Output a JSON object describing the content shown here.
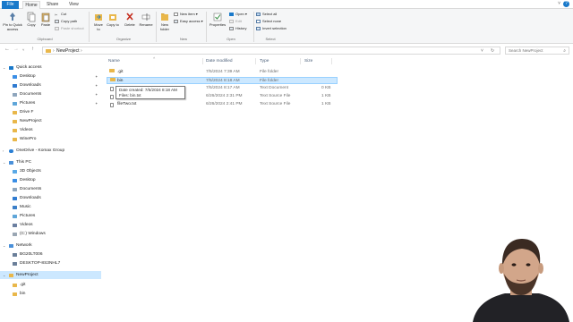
{
  "tabs": {
    "file": "File",
    "home": "Home",
    "share": "Share",
    "view": "View"
  },
  "ribbon": {
    "pin_quick_access": "Pin to Quick access",
    "copy": "Copy",
    "paste": "Paste",
    "cut": "Cut",
    "copy_path": "Copy path",
    "paste_shortcut": "Paste shortcut",
    "clipboard_group": "Clipboard",
    "move_to": "Move to",
    "copy_to": "Copy to",
    "delete": "Delete",
    "rename": "Rename",
    "organize_group": "Organize",
    "new_folder": "New folder",
    "new_item": "New item",
    "easy_access": "Easy access",
    "new_group": "New",
    "properties": "Properties",
    "open": "Open",
    "edit": "Edit",
    "history": "History",
    "open_group": "Open",
    "select_all": "Select all",
    "select_none": "Select none",
    "invert_selection": "Invert selection",
    "select_group": "Select"
  },
  "address": {
    "crumb": "NewProject",
    "search_placeholder": "Search NewProject"
  },
  "navpane": {
    "quick_access": "Quick access",
    "quick_items": [
      "Desktop",
      "Downloads",
      "Documents",
      "Pictures",
      "Drive F",
      "NewProject",
      "Videos",
      "WinePro"
    ],
    "onedrive": "OneDrive - Komax Group",
    "this_pc": "This PC",
    "pc_items": [
      "3D Objects",
      "Desktop",
      "Documents",
      "Downloads",
      "Music",
      "Pictures",
      "Videos",
      "(C:) Windows"
    ],
    "network": "Network",
    "network_items": [
      "BG20LT006",
      "DESKTOP-8S3NHL7"
    ],
    "current_folder": "NewProject",
    "sub_items": [
      ".git",
      "bin"
    ]
  },
  "columns": {
    "name": "Name",
    "date": "Date modified",
    "type": "Type",
    "size": "Size"
  },
  "files": [
    {
      "name": ".git",
      "date": "7/5/2024 7:39 AM",
      "type": "File folder",
      "size": ""
    },
    {
      "name": "bin",
      "date": "7/5/2024 8:18 AM",
      "type": "File folder",
      "size": ""
    },
    {
      "name": "",
      "date": "7/5/2024 8:17 AM",
      "type": "Text Document",
      "size": "0 KB"
    },
    {
      "name": "",
      "date": "6/26/2024 2:31 PM",
      "type": "Text Source File",
      "size": "1 KB"
    },
    {
      "name": "fileTwo.txt",
      "date": "6/26/2024 2:41 PM",
      "type": "Text Source File",
      "size": "1 KB"
    }
  ],
  "tooltip": {
    "line1": "Date created: 7/5/2024 8:18 AM",
    "line2": "Files: bin.txt"
  },
  "colors": {
    "accent": "#1979ca",
    "folder": "#e9b74a",
    "selection": "#cce8ff"
  }
}
